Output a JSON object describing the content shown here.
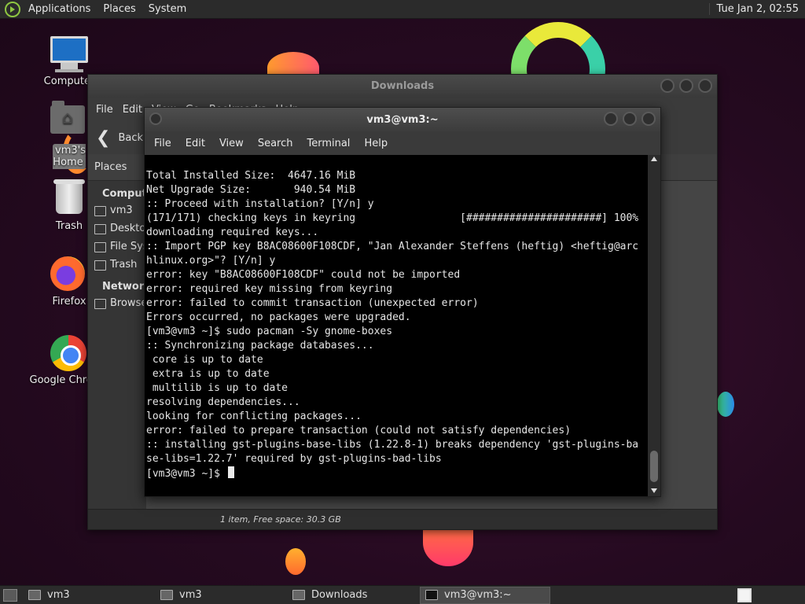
{
  "top_panel": {
    "menus": [
      "Applications",
      "Places",
      "System"
    ],
    "clock": "Tue Jan  2, 02:55"
  },
  "desktop_icons": [
    {
      "label": "Computer"
    },
    {
      "label": "vm3's Home"
    },
    {
      "label": "Trash"
    },
    {
      "label": "Firefox"
    },
    {
      "label": "Google Chrome"
    }
  ],
  "file_manager": {
    "title": "Downloads",
    "menus": [
      "File",
      "Edit",
      "View",
      "Go",
      "Bookmarks",
      "Help"
    ],
    "back_label": "Back",
    "sidebar_header": "Places",
    "sidebar_groups": [
      {
        "title": "Computer",
        "items": [
          "vm3",
          "Desktop",
          "File System",
          "Trash"
        ]
      },
      {
        "title": "Network",
        "items": [
          "Browse Network"
        ]
      }
    ],
    "status": "1 item, Free space: 30.3 GB"
  },
  "terminal": {
    "title": "vm3@vm3:~",
    "menus": [
      "File",
      "Edit",
      "View",
      "Search",
      "Terminal",
      "Help"
    ],
    "lines": [
      "Total Installed Size:  4647.16 MiB",
      "Net Upgrade Size:       940.54 MiB",
      "",
      ":: Proceed with installation? [Y/n] y",
      "(171/171) checking keys in keyring                 [######################] 100%",
      "downloading required keys...",
      ":: Import PGP key B8AC08600F108CDF, \"Jan Alexander Steffens (heftig) <heftig@arc",
      "hlinux.org>\"? [Y/n] y",
      "error: key \"B8AC08600F108CDF\" could not be imported",
      "error: required key missing from keyring",
      "error: failed to commit transaction (unexpected error)",
      "Errors occurred, no packages were upgraded.",
      "[vm3@vm3 ~]$ sudo pacman -Sy gnome-boxes",
      ":: Synchronizing package databases...",
      " core is up to date",
      " extra is up to date",
      " multilib is up to date",
      "resolving dependencies...",
      "looking for conflicting packages...",
      "error: failed to prepare transaction (could not satisfy dependencies)",
      ":: installing gst-plugins-base-libs (1.22.8-1) breaks dependency 'gst-plugins-ba",
      "se-libs=1.22.7' required by gst-plugins-bad-libs"
    ],
    "prompt": "[vm3@vm3 ~]$ "
  },
  "taskbar": {
    "tasks": [
      "vm3",
      "vm3",
      "Downloads",
      "vm3@vm3:~"
    ]
  }
}
